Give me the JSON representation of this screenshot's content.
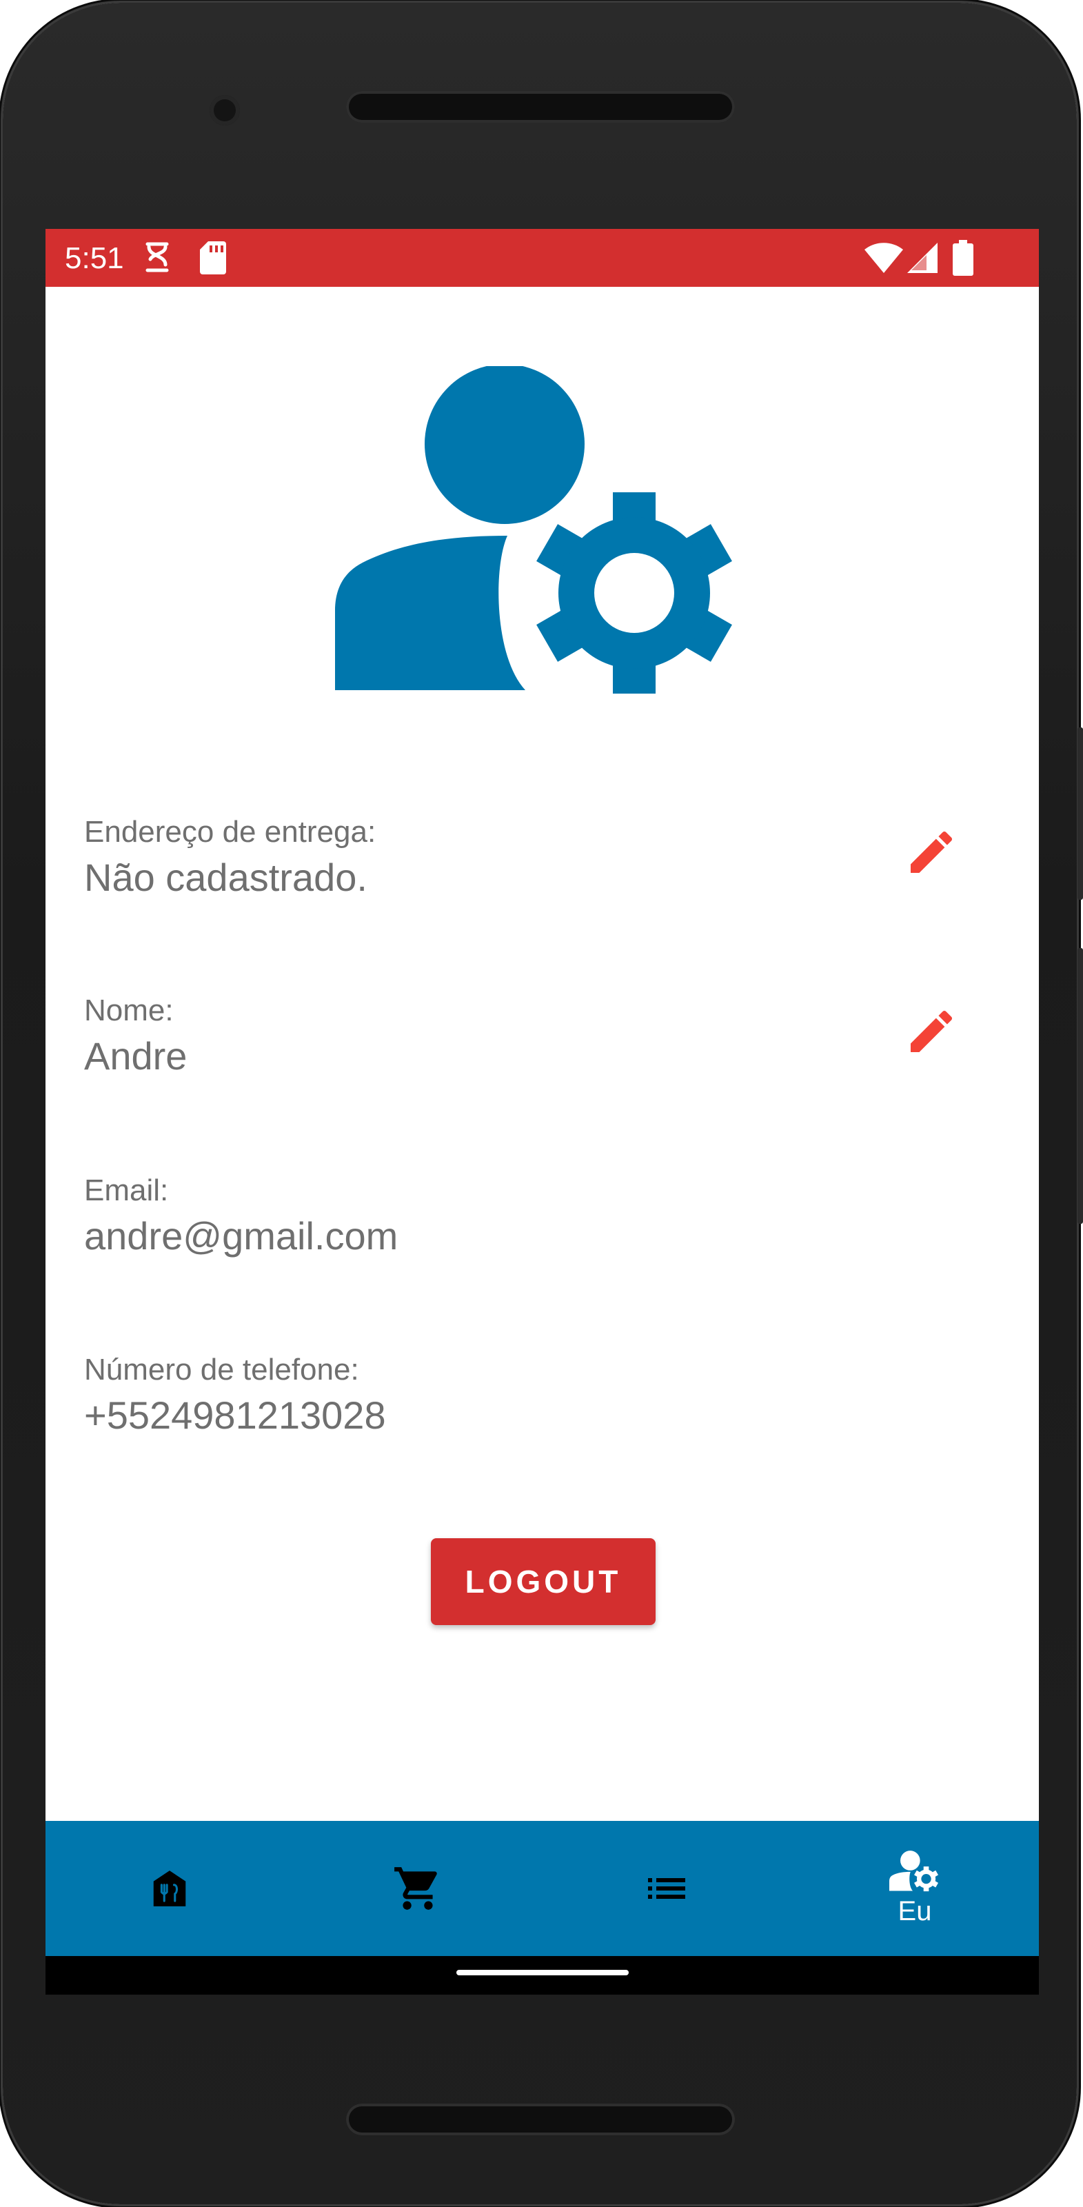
{
  "status_bar": {
    "time": "5:51",
    "background": "#d32f2f"
  },
  "profile": {
    "fields": [
      {
        "label": "Endereço de entrega:",
        "value": "Não cadastrado.",
        "editable": true
      },
      {
        "label": "Nome:",
        "value": "Andre",
        "editable": true
      },
      {
        "label": "Email:",
        "value": "andre@gmail.com",
        "editable": false
      },
      {
        "label": "Número de telefone:",
        "value": "+5524981213028",
        "editable": false
      }
    ],
    "logout_label": "LOGOUT"
  },
  "bottom_nav": {
    "background": "#0077ad",
    "items": [
      {
        "icon": "restaurant-home-icon",
        "label": ""
      },
      {
        "icon": "cart-icon",
        "label": ""
      },
      {
        "icon": "list-icon",
        "label": ""
      },
      {
        "icon": "user-settings-icon",
        "label": "Eu",
        "active": true
      }
    ]
  },
  "colors": {
    "accent": "#d32f2f",
    "primary": "#0077ad",
    "text_secondary": "#6f6f6f"
  }
}
